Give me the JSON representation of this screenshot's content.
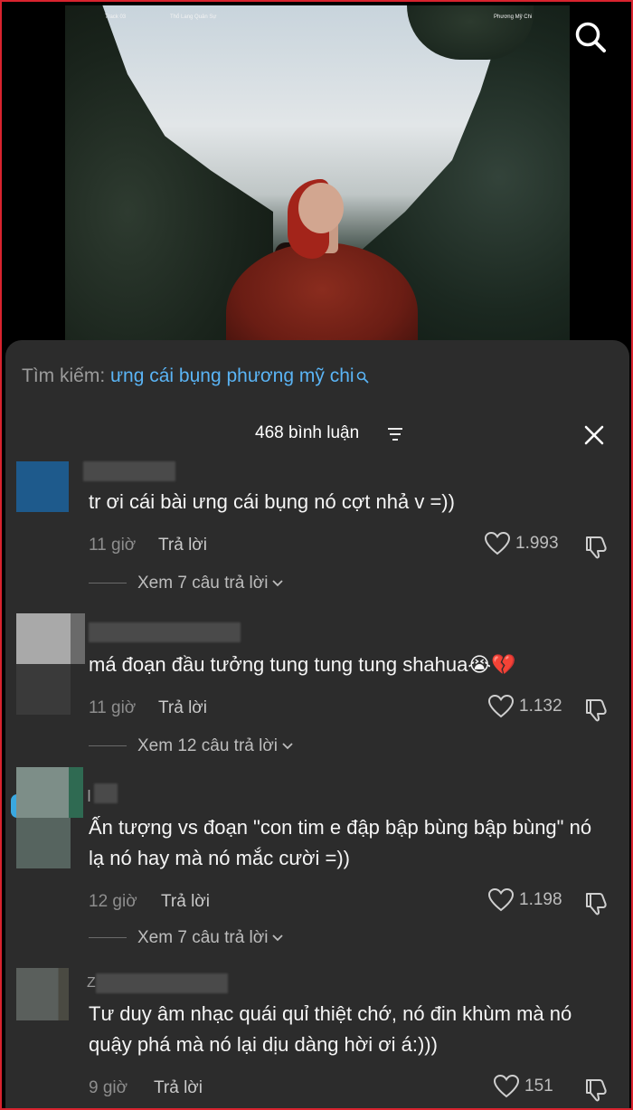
{
  "video": {
    "top_labels": [
      "Track 03",
      "Thổ Lang Quản Sự",
      "Phương Mỹ Chi",
      ""
    ],
    "search_icon": "search-icon"
  },
  "suggest": {
    "label": "Tìm kiếm: ",
    "query": "ưng cái bụng phương mỹ chi"
  },
  "header": {
    "count": "468 bình luận"
  },
  "comments": [
    {
      "text": "tr ơi cái bài ưng cái bụng nó cợt nhả v =))",
      "time": "11 giờ",
      "reply": "Trả lời",
      "likes": "1.993",
      "view_replies": "Xem 7 câu trả lời"
    },
    {
      "text": "má đoạn đầu tưởng tung tung tung shahua😭💔",
      "time": "11 giờ",
      "reply": "Trả lời",
      "likes": "1.132",
      "view_replies": "Xem 12 câu trả lời"
    },
    {
      "name_initial": "I",
      "text": "Ấn tượng vs đoạn \"con tim e đập bập bùng bập bùng\" nó lạ nó hay mà nó mắc cười =))",
      "time": "12 giờ",
      "reply": "Trả lời",
      "likes": "1.198",
      "view_replies": "Xem 7 câu trả lời"
    },
    {
      "name_initial": "Z",
      "text": "Tư duy âm nhạc quái quỉ thiệt chớ, nó đin khùm mà nó quậy phá mà nó lại dịu dàng hời ơi á:)))",
      "time": "9 giờ",
      "reply": "Trả lời",
      "likes": "151"
    }
  ],
  "colors": {
    "frame_border": "#d9232e",
    "sheet_bg": "#2c2c2c",
    "query_blue": "#5ab4f5"
  }
}
